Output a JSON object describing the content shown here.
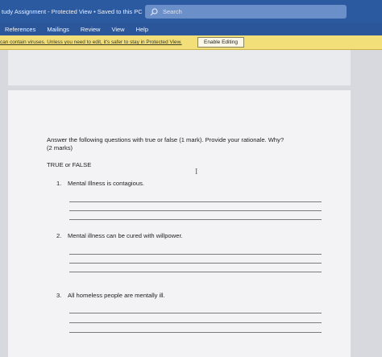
{
  "titlebar": {
    "title": "tudy Assignment  -  Protected View • Saved to this PC",
    "search_label": "Search"
  },
  "ribbon": {
    "tabs": [
      "References",
      "Mailings",
      "Review",
      "View",
      "Help"
    ]
  },
  "message_bar": {
    "text": "can contain viruses. Unless you need to edit, it's safer to stay in Protected View.",
    "button_label": "Enable Editing"
  },
  "document": {
    "instruction_line1": "Answer the following questions with true or false (1 mark). Provide your rationale. Why?",
    "instruction_line2": "(2 marks)",
    "section_title": "TRUE or FALSE",
    "questions": [
      {
        "number": "1.",
        "text": "Mental Illness is contagious."
      },
      {
        "number": "2.",
        "text": "Mental illness can be cured with willpower."
      },
      {
        "number": "3.",
        "text": "All homeless people are mentally ill."
      }
    ]
  },
  "colors": {
    "titlebar": "#2c5aa0",
    "message_bar": "#f2df7a"
  }
}
